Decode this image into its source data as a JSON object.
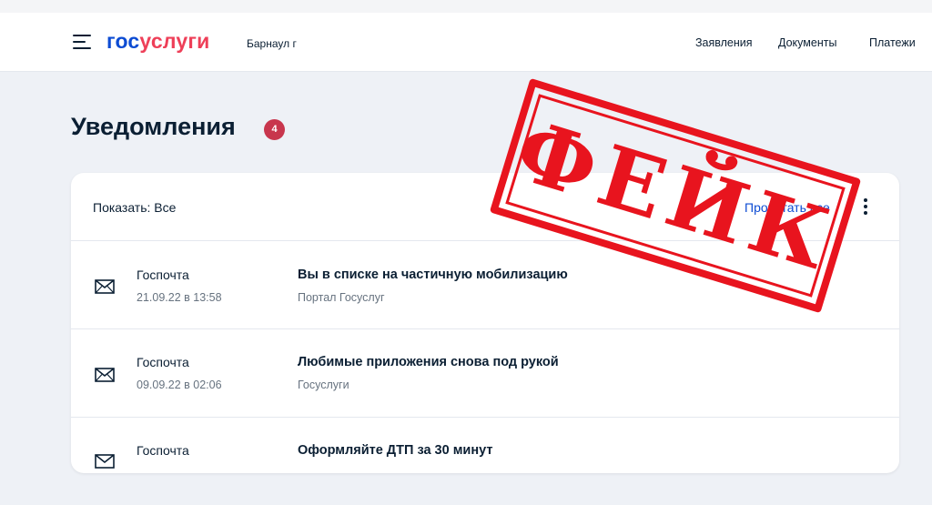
{
  "header": {
    "logo_part1": "гос",
    "logo_part2": "услуги",
    "city": "Барнаул г",
    "nav": [
      "Заявления",
      "Документы",
      "Платежи"
    ]
  },
  "page": {
    "title": "Уведомления",
    "badge_count": "4"
  },
  "toolbar": {
    "filter_label": "Показать: Все",
    "read_all_label": "Прочитать все"
  },
  "notifications": [
    {
      "source": "Госпочта",
      "date": "21.09.22 в 13:58",
      "subject": "Вы в списке на частичную мобилизацию",
      "sender": "Портал Госуслуг",
      "icon": "envelope-icon"
    },
    {
      "source": "Госпочта",
      "date": "09.09.22 в 02:06",
      "subject": "Любимые приложения снова под рукой",
      "sender": "Госуслуги",
      "icon": "envelope-icon"
    },
    {
      "source": "Госпочта",
      "date": "",
      "subject": "Оформляйте ДТП за 30 минут",
      "sender": "",
      "icon": "envelope-icon"
    }
  ],
  "overlay": {
    "stamp_text": "ФЕЙК"
  },
  "colors": {
    "brand_blue": "#0d4cd3",
    "brand_red": "#ee3f58",
    "badge": "#c8364d",
    "stamp_red": "#e8141e",
    "page_bg": "#eef1f6"
  }
}
